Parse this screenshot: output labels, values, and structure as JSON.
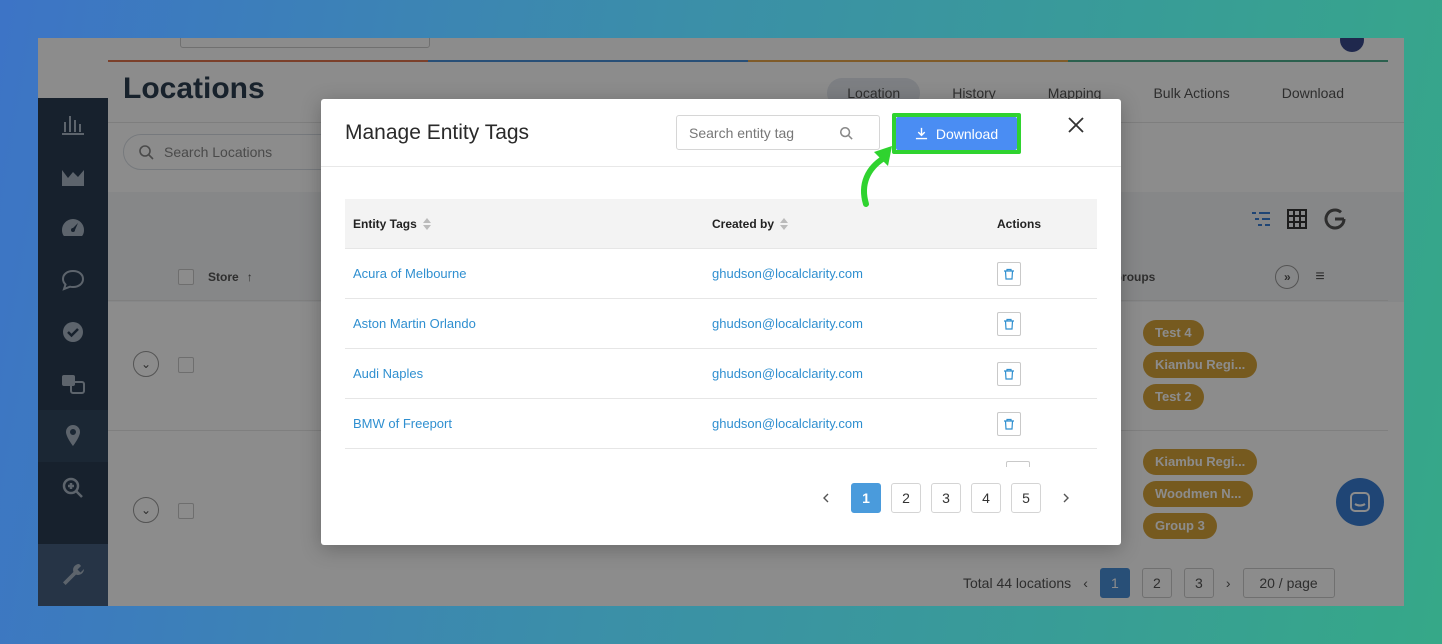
{
  "app": {
    "page_title": "Locations",
    "tabs": [
      {
        "label": "Location"
      },
      {
        "label": "History"
      },
      {
        "label": "Mapping"
      },
      {
        "label": "Bulk Actions"
      },
      {
        "label": "Download"
      }
    ],
    "search_placeholder": "Search Locations",
    "table_headers": {
      "store": "Store",
      "groups": "Groups"
    },
    "row_groups": [
      [
        "Test 4",
        "Kiambu Regi...",
        "Test 2"
      ],
      [
        "Kiambu Regi...",
        "Woodmen N...",
        "Group 3"
      ]
    ],
    "footer": {
      "total": "Total 44 locations",
      "pages": [
        "1",
        "2",
        "3"
      ],
      "per_page": "20 / page"
    }
  },
  "modal": {
    "title": "Manage Entity Tags",
    "search_placeholder": "Search entity tag",
    "download_label": "Download",
    "columns": {
      "entity_tags": "Entity Tags",
      "created_by": "Created by",
      "actions": "Actions"
    },
    "rows": [
      {
        "tag": "Acura of Melbourne",
        "created_by": "ghudson@localclarity.com"
      },
      {
        "tag": "Aston Martin Orlando",
        "created_by": "ghudson@localclarity.com"
      },
      {
        "tag": "Audi Naples",
        "created_by": "ghudson@localclarity.com"
      },
      {
        "tag": "BMW of Freeport",
        "created_by": "ghudson@localclarity.com"
      }
    ],
    "pages": [
      "1",
      "2",
      "3",
      "4",
      "5"
    ],
    "current_page": "1"
  },
  "colors": {
    "highlight": "#2fd32f",
    "download_button": "#4a8df3",
    "link": "#2f8fd0",
    "tag": "#d7a43a"
  }
}
